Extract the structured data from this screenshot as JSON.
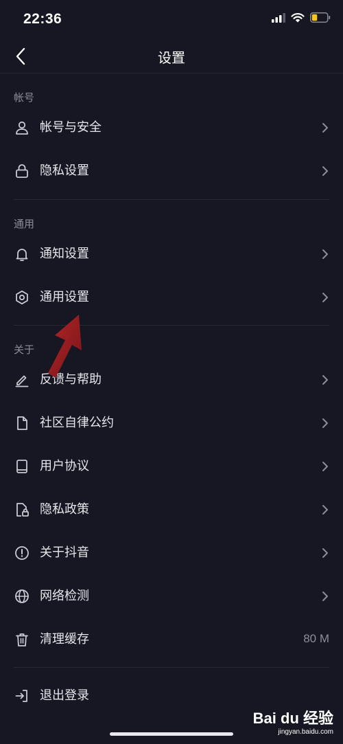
{
  "status_bar": {
    "time": "22:36"
  },
  "nav": {
    "title": "设置"
  },
  "sections": {
    "account": "帐号",
    "general": "通用",
    "about": "关于"
  },
  "rows": {
    "account_security": "帐号与安全",
    "privacy_settings": "隐私设置",
    "notification_settings": "通知设置",
    "general_settings": "通用设置",
    "feedback_help": "反馈与帮助",
    "community_rules": "社区自律公约",
    "user_agreement": "用户协议",
    "privacy_policy": "隐私政策",
    "about_douyin": "关于抖音",
    "network_check": "网络检测",
    "clear_cache": "清理缓存",
    "cache_size": "80 M",
    "logout": "退出登录"
  },
  "watermark": {
    "logo": "Bai du 经验",
    "url": "jingyan.baidu.com"
  },
  "colors": {
    "background": "#161722",
    "text": "#e6e7ec",
    "secondary_text": "#8c8e98",
    "annotation_arrow": "#9b1b1f",
    "battery": "#f5c518"
  }
}
